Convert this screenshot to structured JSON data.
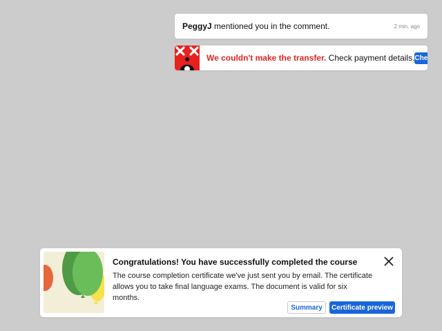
{
  "mention_toast": {
    "user": "PeggyJ",
    "message": " mentioned you in the comment.",
    "time": "2 min. ago"
  },
  "error_toast": {
    "headline": "We couldn't make the transfer.",
    "detail": " Check payment details.",
    "button_label": "Check",
    "accent_color": "#e02424"
  },
  "course_toast": {
    "title": "Congratulations! You have successfully completed the course",
    "body": "The course completion certificate we've just sent you by email. The certificate allows you to take final language exams. The document is valid for six months.",
    "summary_label": "Summary",
    "certificate_label": "Certificate preview",
    "primary_color": "#1a66d9"
  },
  "icons": {
    "close": "close-icon",
    "error_thumb": "error-thumbnail-icon",
    "balloons": "balloons-illustration"
  }
}
